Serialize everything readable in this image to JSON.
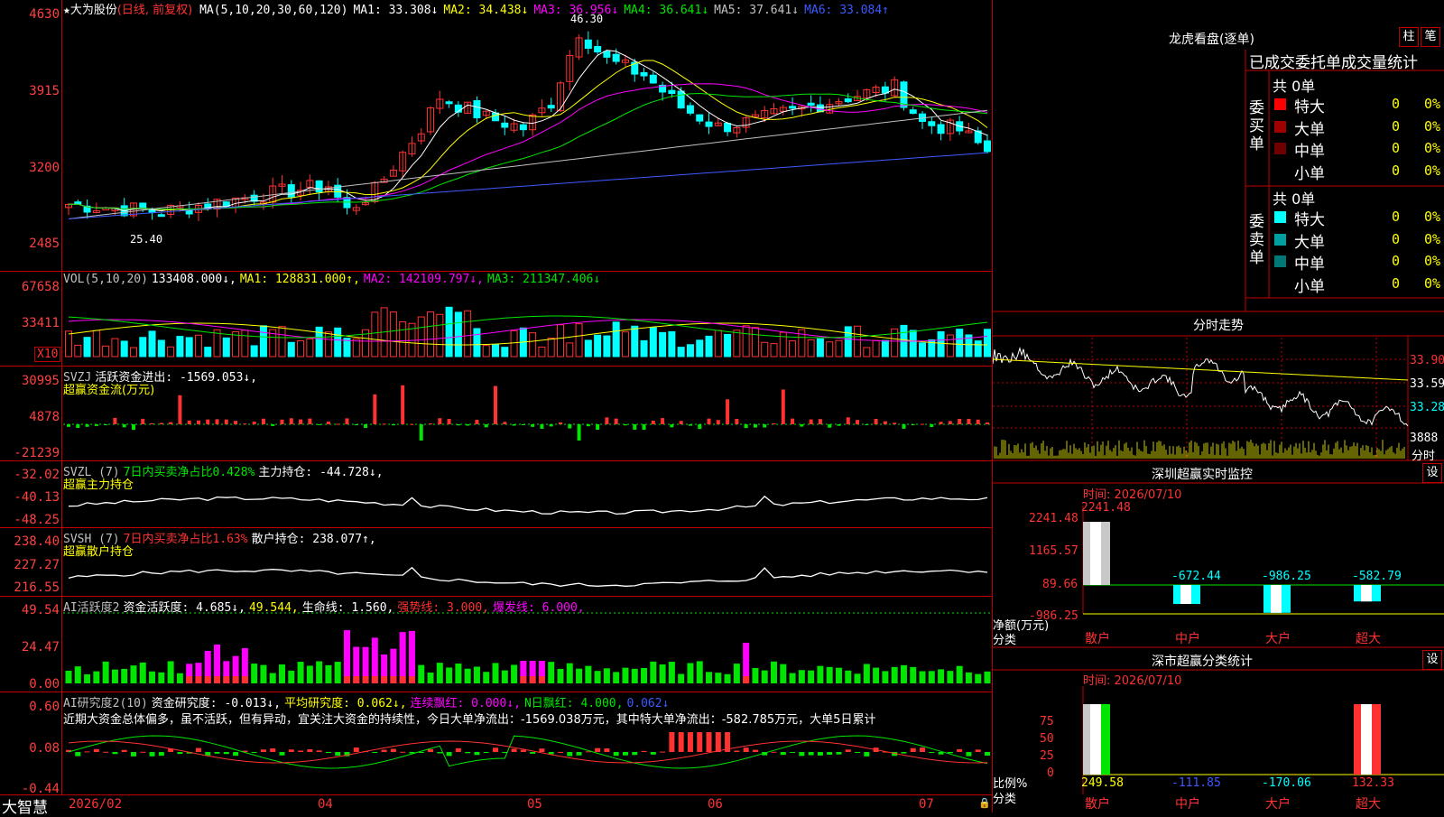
{
  "chart_data": {
    "type": "candlestick",
    "title": "大为股份",
    "subtitle": "(日线, 前复权)",
    "y_ticks": [
      "4630",
      "3915",
      "3200",
      "2485"
    ],
    "price_high_label": "46.30",
    "price_low_label": "25.40",
    "x_ticks": [
      "2026/02",
      "04",
      "05",
      "06",
      "07"
    ],
    "note": "price axis labels shown ×100",
    "ma_legend": [
      {
        "name": "MA(5,10,20,30,60,120)",
        "value": "",
        "color": "#ffffff"
      },
      {
        "name": "MA1:",
        "value": "33.308↓",
        "color": "#ffffff"
      },
      {
        "name": "MA2:",
        "value": "34.438↓",
        "color": "#ffff00"
      },
      {
        "name": "MA3:",
        "value": "36.956↓",
        "color": "#ff00ff"
      },
      {
        "name": "MA4:",
        "value": "36.641↓",
        "color": "#00e600"
      },
      {
        "name": "MA5:",
        "value": "37.641↓",
        "color": "#c0c0c0"
      },
      {
        "name": "MA6:",
        "value": "33.084↑",
        "color": "#3c5aff"
      }
    ]
  },
  "panels": {
    "vol": {
      "legend": [
        {
          "text": "VOL(5,10,20)",
          "color": "#c0c0c0"
        },
        {
          "text": "133408.000↓,",
          "color": "#ffffff"
        },
        {
          "text": "MA1: 128831.000↑,",
          "color": "#ffff00"
        },
        {
          "text": "MA2: 142109.797↓,",
          "color": "#ff00ff"
        },
        {
          "text": "MA3: 211347.406↓",
          "color": "#00e600"
        }
      ],
      "y_ticks": [
        "67658",
        "33411"
      ],
      "unit": "X10"
    },
    "svzj": {
      "legend": [
        {
          "text": "SVZJ",
          "color": "#c0c0c0"
        },
        {
          "text": "活跃资金进出: -1569.053↓,",
          "color": "#ffffff"
        }
      ],
      "subtitle": "超赢资金流(万元)",
      "y_ticks": [
        "30995",
        "4878",
        "-21239"
      ]
    },
    "svzl": {
      "legend": [
        {
          "text": "SVZL (7)",
          "color": "#c0c0c0"
        },
        {
          "text": "7日内买卖净占比0.428%",
          "color": "#00e600"
        },
        {
          "text": "主力持仓: -44.728↓,",
          "color": "#ffffff"
        }
      ],
      "subtitle": "超赢主力持仓",
      "y_ticks": [
        "-32.02",
        "-40.13",
        "-48.25"
      ]
    },
    "svsh": {
      "legend": [
        {
          "text": "SVSH (7)",
          "color": "#c0c0c0"
        },
        {
          "text": "7日内买卖净占比1.63%",
          "color": "#ff3232"
        },
        {
          "text": "散户持仓: 238.077↑,",
          "color": "#ffffff"
        }
      ],
      "subtitle": "超赢散户持仓",
      "y_ticks": [
        "238.40",
        "227.27",
        "216.55"
      ]
    },
    "ai1": {
      "legend": [
        {
          "text": "AI活跃度2",
          "color": "#c0c0c0"
        },
        {
          "text": "资金活跃度: 4.685↓,",
          "color": "#ffffff"
        },
        {
          "text": "49.544,",
          "color": "#ffff00"
        },
        {
          "text": "生命线: 1.560,",
          "color": "#ffffff"
        },
        {
          "text": "强势线: 3.000,",
          "color": "#ff3232"
        },
        {
          "text": "爆发线: 6.000,",
          "color": "#ff00ff"
        }
      ],
      "y_ticks": [
        "49.54",
        "24.47",
        "0.00"
      ]
    },
    "ai2": {
      "legend": [
        {
          "text": "AI研究度2(10)",
          "color": "#c0c0c0"
        },
        {
          "text": "资金研究度: -0.013↓,",
          "color": "#ffffff"
        },
        {
          "text": "平均研究度: 0.062↓,",
          "color": "#ffff00"
        },
        {
          "text": "连续飘红: 0.000↓,",
          "color": "#ff00ff"
        },
        {
          "text": "N日飘红: 4.000,",
          "color": "#00e600"
        },
        {
          "text": "0.062↓",
          "color": "#3c5aff"
        }
      ],
      "commentary": "近期大资金总体偏多，虽不活跃，但有异动，宜关注大资金的持续性，今日大单净流出：-1569.038万元，其中特大单净流出：-582.785万元，大单5日累计",
      "y_ticks": [
        "0.60",
        "0.08",
        "-0.44"
      ]
    }
  },
  "bottom": {
    "logo": "大智慧"
  },
  "dragon": {
    "title": "龙虎看盘(逐单)",
    "btn_a": "柱",
    "btn_b": "笔",
    "tabs_text": "已成交委托单成交量统计",
    "buy": {
      "side": "委买单",
      "total": "共 0单",
      "rows": [
        {
          "label": "特大",
          "count": "0",
          "pct": "0%",
          "color": "#ff0000"
        },
        {
          "label": "大单",
          "count": "0",
          "pct": "0%",
          "color": "#a00000"
        },
        {
          "label": "中单",
          "count": "0",
          "pct": "0%",
          "color": "#700000"
        },
        {
          "label": "小单",
          "count": "0",
          "pct": "0%",
          "color": "#000000"
        }
      ]
    },
    "sell": {
      "side": "委卖单",
      "total": "共 0单",
      "rows": [
        {
          "label": "特大",
          "count": "0",
          "pct": "0%",
          "color": "#00ffff"
        },
        {
          "label": "大单",
          "count": "0",
          "pct": "0%",
          "color": "#00a0a0"
        },
        {
          "label": "中单",
          "count": "0",
          "pct": "0%",
          "color": "#007878"
        },
        {
          "label": "小单",
          "count": "0",
          "pct": "0%",
          "color": "#000000"
        }
      ]
    }
  },
  "intraday": {
    "title": "分时走势",
    "y_ticks": [
      "33.90",
      "33.59",
      "33.28"
    ],
    "vol_label": "3888",
    "footer": "分时"
  },
  "monitor": {
    "title": "深圳超赢实时监控",
    "time_label": "时间: 2026/07/10",
    "settings": "设",
    "y_ticks": [
      "2241.48",
      "1165.57",
      "89.66",
      "-986.25"
    ],
    "y_axis_name": "净额(万元)",
    "x_axis_name": "分类",
    "chart_data": {
      "type": "bar",
      "categories": [
        "散户",
        "中户",
        "大户",
        "超大"
      ],
      "values": [
        2241.48,
        -672.44,
        -986.25,
        -582.79
      ],
      "value_labels": [
        "2241.48",
        "-672.44",
        "-986.25",
        "-582.79"
      ]
    }
  },
  "classify": {
    "title": "深市超赢分类统计",
    "time_label": "时间: 2026/07/10",
    "settings": "设",
    "y_ticks": [
      "75",
      "50",
      "25",
      "0"
    ],
    "y_axis_name": "比例%",
    "x_axis_name": "分类",
    "chart_data": {
      "type": "bar",
      "categories": [
        "散户",
        "中户",
        "大户",
        "超大"
      ],
      "values": [
        249.58,
        -111.85,
        -170.06,
        132.33
      ],
      "value_labels": [
        "249.58",
        "-111.85",
        "-170.06",
        "132.33"
      ]
    }
  }
}
